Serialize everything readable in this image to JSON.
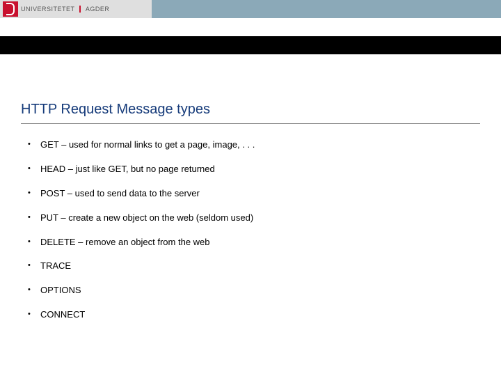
{
  "header": {
    "institution_a": "UNIVERSITETET",
    "institution_b": "AGDER"
  },
  "slide": {
    "title": "HTTP Request Message types",
    "items": [
      "GET – used for normal links to get a page, image, . . .",
      "HEAD – just like GET, but no page returned",
      "POST – used to send data to the server",
      "PUT – create a new object on the web (seldom used)",
      "DELETE – remove an object from the web",
      "TRACE",
      "OPTIONS",
      "CONNECT"
    ]
  }
}
